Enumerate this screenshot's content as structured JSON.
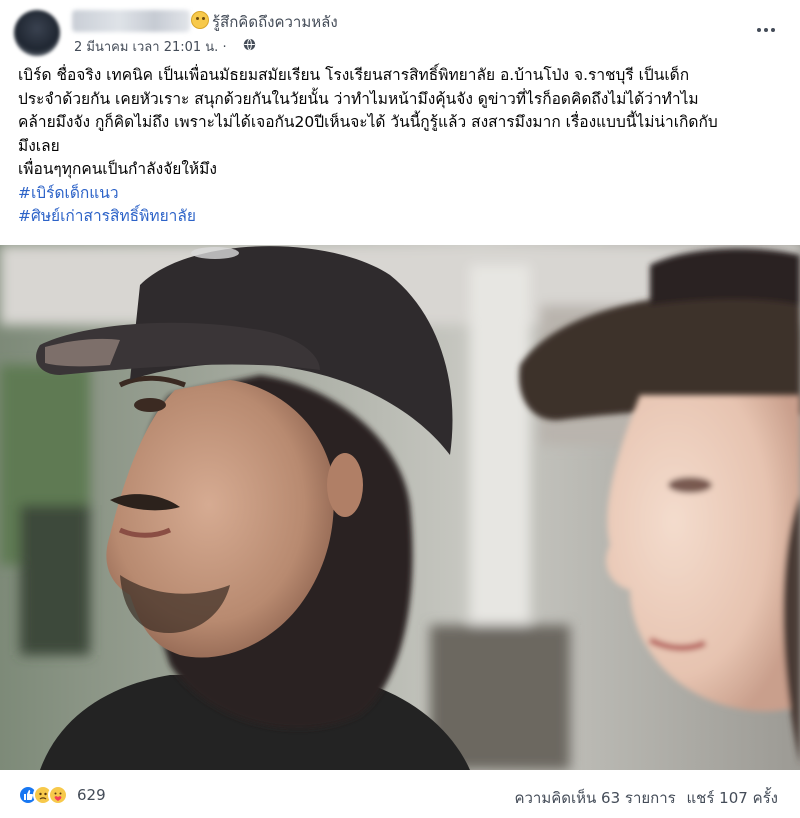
{
  "post": {
    "feeling": "รู้สึกคิดถึงความหลัง",
    "timestamp": "2 มีนาคม เวลา 21:01 น. ·",
    "privacy_icon": "globe-icon",
    "more_icon": "more-options-icon",
    "body_lines": [
      "เบิร์ด ชื่อจริง เทคนิค เป็นเพื่อนมัธยมสมัยเรียน โรงเรียนสารสิทธิ์พิทยาลัย อ.บ้านโป่ง จ.ราชบุรี เป็นเด็ก",
      "ประจำด้วยกัน เคยหัวเราะ สนุกด้วยกันในวัยนั้น ว่าทำไมหน้ามึงคุ้นจัง ดูข่าวที่ไรก็อดคิดถึงไม่ได้ว่าทำไม",
      "คล้ายมึงจัง กูก็คิดไม่ถึง เพราะไม่ได้เจอกัน20ปีเห็นจะได้ วันนี้กูรู้แล้ว สงสารมึงมาก เรื่องแบบนี้ไม่น่าเกิดกับ",
      "มึงเลย",
      "เพื่อนๆทุกคนเป็นกำลังจัยให้มึง"
    ],
    "hashtags": [
      "#เบิร์ดเด็กแนว",
      "#ศิษย์เก่าสารสิทธิ์พิทยาลัย"
    ]
  },
  "footer": {
    "reaction_icons": [
      "like-icon",
      "sad-icon",
      "care-icon"
    ],
    "reaction_count": "629",
    "comments": "ความคิดเห็น 63 รายการ",
    "shares": "แชร์ 107 ครั้ง"
  },
  "colors": {
    "hashtag": "#2d63c8",
    "meta_text": "#444c58",
    "like_blue": "#1877f2"
  }
}
